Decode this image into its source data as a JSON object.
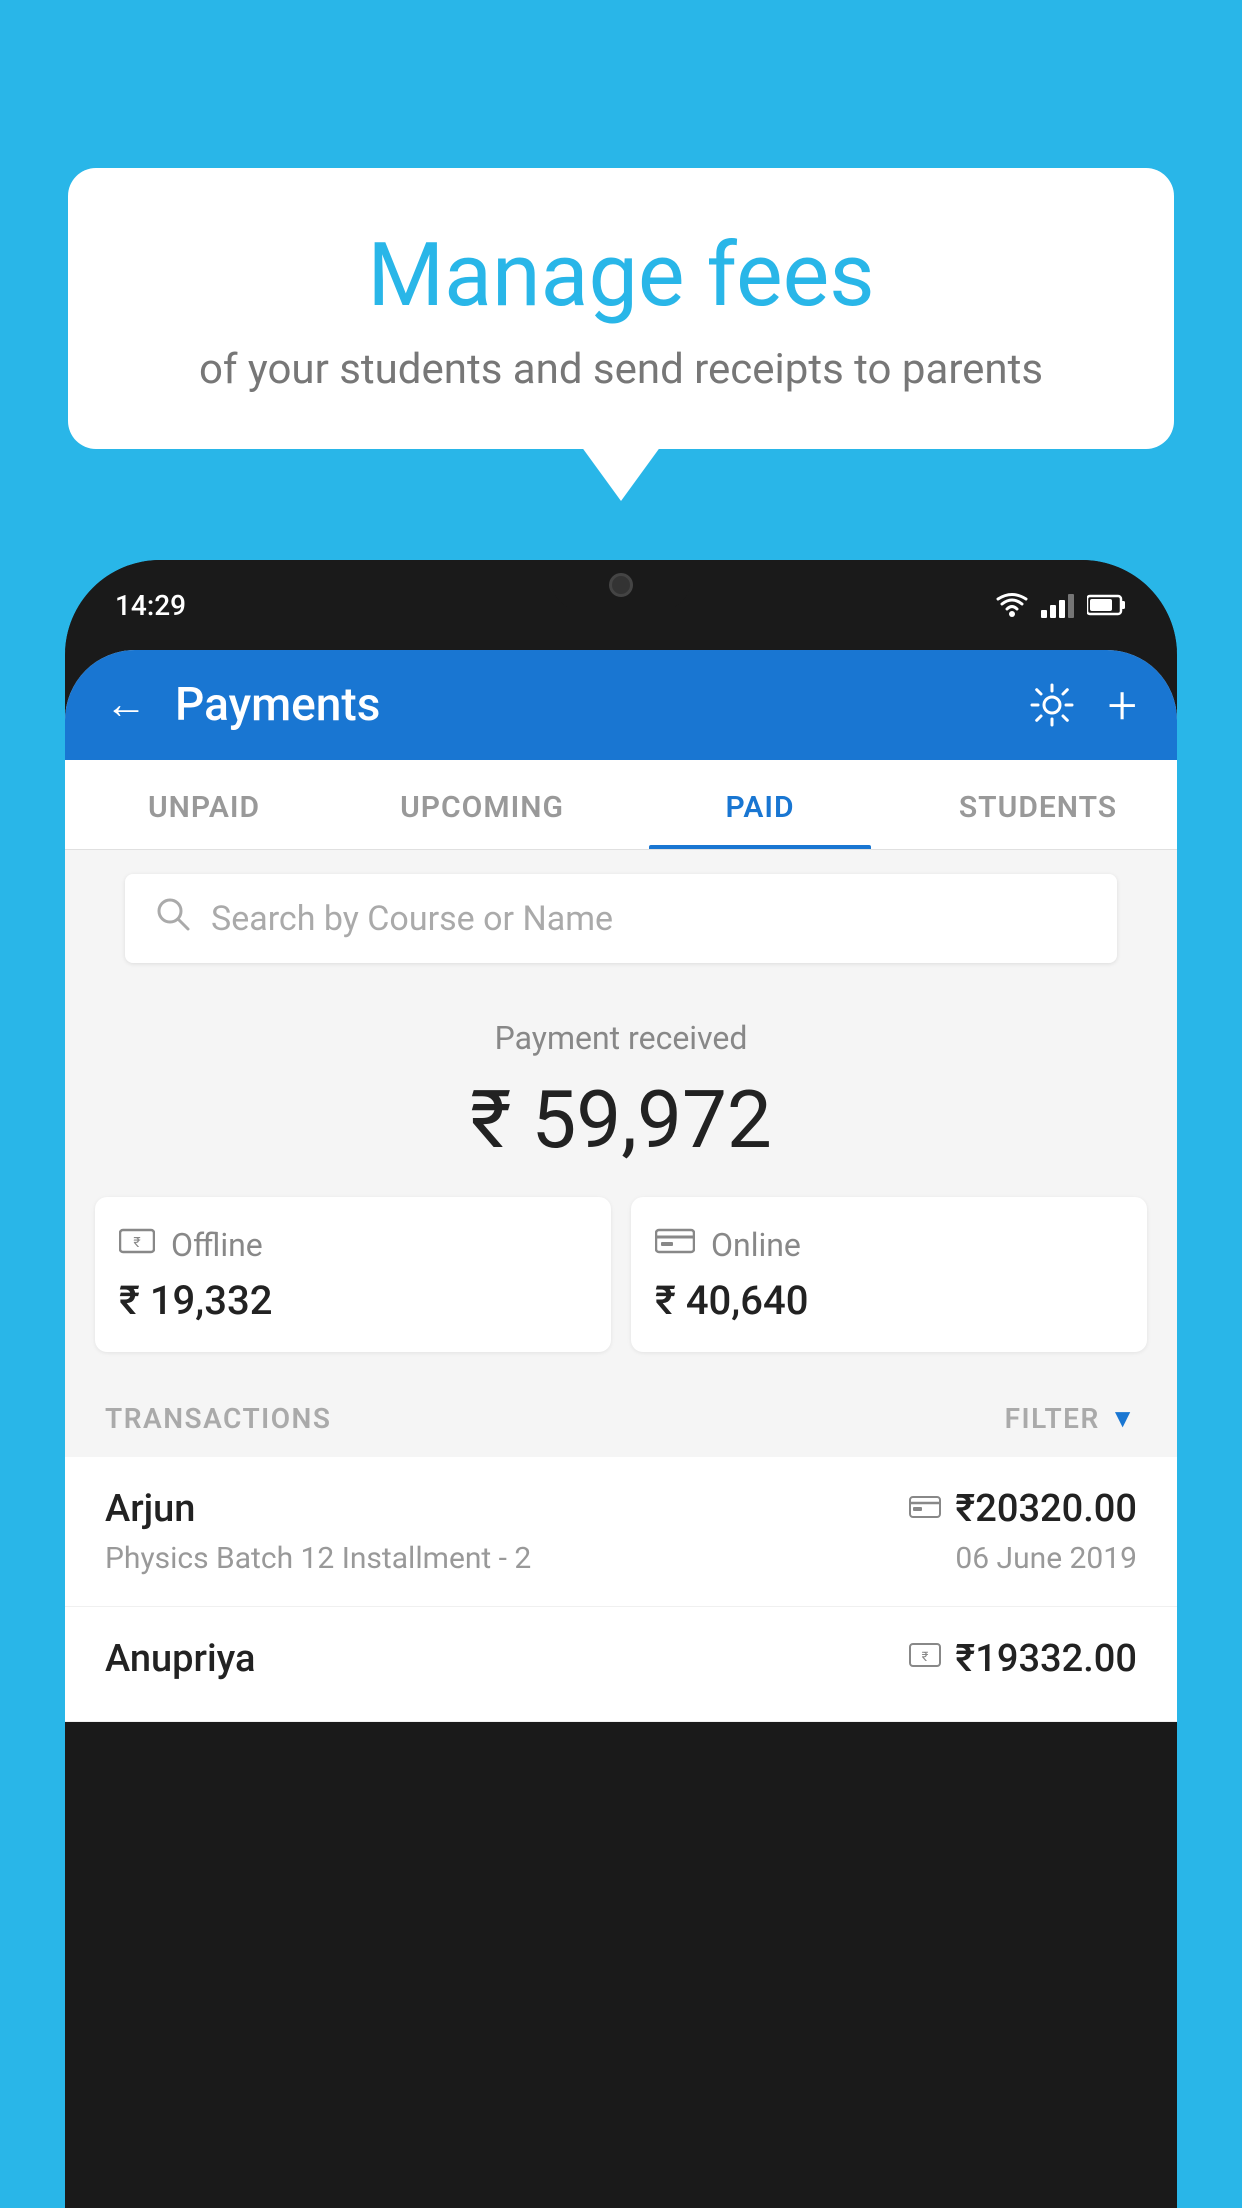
{
  "background_color": "#29B6E8",
  "bubble": {
    "title": "Manage fees",
    "subtitle": "of your students and send receipts to parents"
  },
  "phone": {
    "status_bar": {
      "time": "14:29"
    },
    "header": {
      "title": "Payments",
      "back_label": "←",
      "settings_label": "⚙",
      "add_label": "+"
    },
    "tabs": [
      {
        "label": "UNPAID",
        "active": false
      },
      {
        "label": "UPCOMING",
        "active": false
      },
      {
        "label": "PAID",
        "active": true
      },
      {
        "label": "STUDENTS",
        "active": false
      }
    ],
    "search": {
      "placeholder": "Search by Course or Name"
    },
    "payment_summary": {
      "label": "Payment received",
      "amount": "₹ 59,972"
    },
    "payment_cards": [
      {
        "icon": "₹",
        "label": "Offline",
        "amount": "₹ 19,332"
      },
      {
        "icon": "▬",
        "label": "Online",
        "amount": "₹ 40,640"
      }
    ],
    "transactions_label": "TRANSACTIONS",
    "filter_label": "FILTER",
    "transactions": [
      {
        "name": "Arjun",
        "course": "Physics Batch 12 Installment - 2",
        "amount": "₹20320.00",
        "date": "06 June 2019",
        "type_icon": "▬"
      },
      {
        "name": "Anupriya",
        "course": "",
        "amount": "₹19332.00",
        "date": "",
        "type_icon": "₹"
      }
    ]
  }
}
